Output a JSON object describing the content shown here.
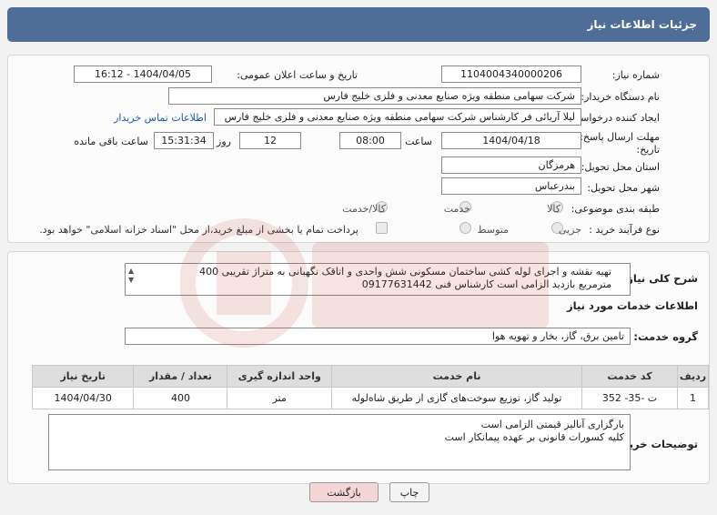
{
  "header": {
    "title": "جزئیات اطلاعات نیاز"
  },
  "form": {
    "need_number_label": "شماره نیاز:",
    "need_number": "1104004340000206",
    "announce_label": "تاریخ و ساعت اعلان عمومی:",
    "announce_value": "1404/04/05 - 16:12",
    "buyer_org_label": "نام دستگاه خریدار:",
    "buyer_org": "شرکت سهامی منطقه ویژه صنایع معدنی و فلزی خلیج فارس",
    "creator_label": "ایجاد کننده درخواست:",
    "creator": "لیلا آریائی فر کارشناس شرکت سهامی منطقه ویژه صنایع معدنی و فلزی خلیج فارس",
    "contact_link": "اطلاعات تماس خریدار",
    "deadline_label_1": "مهلت ارسال پاسخ: تا",
    "deadline_label_2": "تاریخ:",
    "deadline_date": "1404/04/18",
    "time_label": "ساعت",
    "deadline_time": "08:00",
    "days_value": "12",
    "days_label": "روز و",
    "remaining_time": "15:31:34",
    "remaining_label": "ساعت باقی مانده",
    "province_label": "استان محل تحویل:",
    "province": "هرمزگان",
    "city_label": "شهر محل تحویل:",
    "city": "بندرعباس",
    "category_label": "طبقه بندی موضوعی:",
    "category_options": [
      "کالا",
      "خدمت",
      "کالا/خدمت"
    ],
    "process_label": "نوع فرآیند خرید :",
    "process_options": [
      "جزیی",
      "متوسط"
    ],
    "payment_note": "پرداخت تمام یا بخشی از مبلغ خرید،از محل \"اسناد خزانه اسلامی\" خواهد بود."
  },
  "summary": {
    "label": "شرح کلی نیاز:",
    "line1": "تهیه نقشه و اجرای لوله کشی ساختمان مسکونی شش واحدی و اتاقک نگهبانی به متراژ تقریبی 400",
    "line2": "مترمربع بازدید الزامی است کارشناس فنی 09177631442"
  },
  "services": {
    "section_title": "اطلاعات خدمات مورد نیاز",
    "group_label": "گروه خدمت:",
    "group_value": "تامین برق، گاز، بخار و تهویه هوا",
    "columns": [
      "ردیف",
      "کد خدمت",
      "نام خدمت",
      "واحد اندازه گیری",
      "تعداد / مقدار",
      "تاریخ نیاز"
    ],
    "rows": [
      {
        "row": "1",
        "code": "ت -35- 352",
        "name": "تولید گاز، توزیع سوخت‌های گازی از طریق شاه‌لوله",
        "unit": "متر",
        "qty": "400",
        "date": "1404/04/30"
      }
    ]
  },
  "notes": {
    "label": "توضیحات خریدار:",
    "line1": "بارگزاری آنالیز قیمتی الزامی است",
    "line2": "کلیه کسورات قانونی بر عهده پیمانکار است"
  },
  "buttons": {
    "print": "چاپ",
    "back": "بازگشت"
  },
  "colors": {
    "header": "#4e6e98",
    "link": "#1a5aa8",
    "back_button": "#f5d5d5"
  }
}
